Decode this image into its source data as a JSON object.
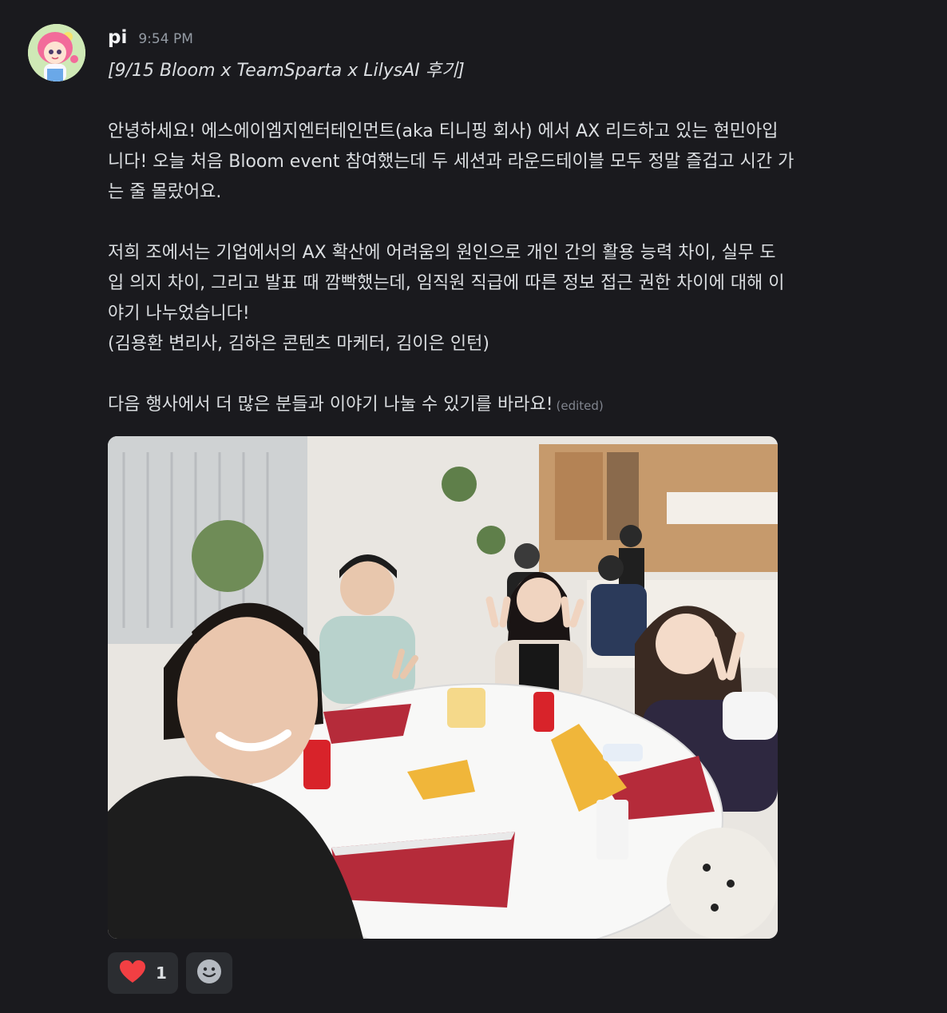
{
  "message": {
    "username": "pi",
    "timestamp": "9:54 PM",
    "title": "[9/15 Bloom x TeamSparta x LilysAI 후기]",
    "paragraph_1": "안녕하세요! 에스에이엠지엔터테인먼트(aka 티니핑 회사) 에서 AX 리드하고 있는 현민아입\n니다! 오늘 처음 Bloom event 참여했는데 두 세션과 라운드테이블 모두 정말 즐겁고 시간 가\n는 줄 몰랐어요.",
    "paragraph_2": "저희 조에서는 기업에서의 AX 확산에 어려움의 원인으로 개인 간의 활용 능력 차이, 실무 도\n입 의지 차이, 그리고 발표 때 깜빡했는데, 임직원 직급에 따른 정보 접근 권한 차이에 대해 이\n야기 나누었습니다!",
    "paragraph_3": "(김용환 변리사, 김하은 콘텐츠 마케터, 김이은 인턴)",
    "paragraph_4": "다음 행사에서 더 많은 분들과 이야기 나눌 수 있기를 바라요!",
    "edited_label": "(edited)"
  },
  "reactions": [
    {
      "icon": "heart-icon",
      "count": "1"
    }
  ],
  "colors": {
    "background": "#1a1a1e",
    "reaction_bg": "#2b2d31",
    "heart": "#f23f43"
  }
}
